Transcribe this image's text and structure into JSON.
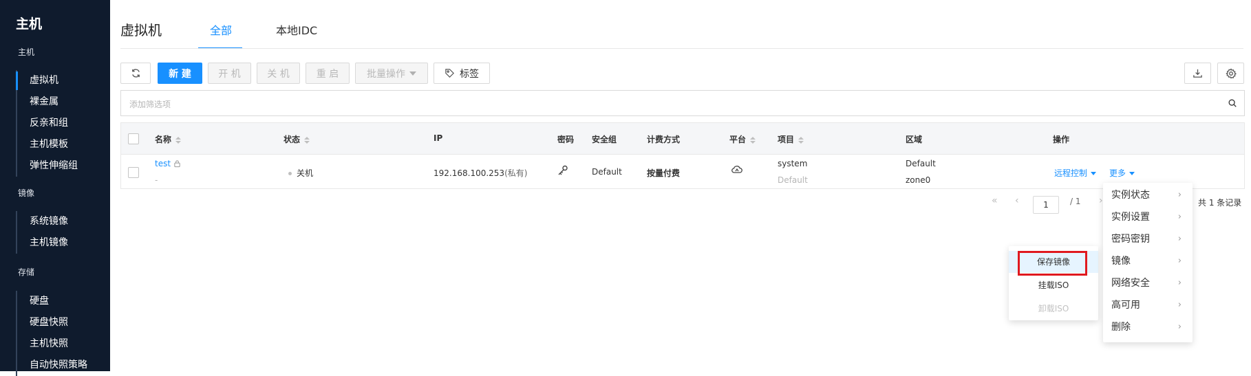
{
  "sidebar": {
    "title": "主机",
    "groups": [
      {
        "label": "主机",
        "items": [
          "虚拟机",
          "裸金属",
          "反亲和组",
          "主机模板",
          "弹性伸缩组"
        ]
      },
      {
        "label": "镜像",
        "items": [
          "系统镜像",
          "主机镜像"
        ]
      },
      {
        "label": "存储",
        "items": [
          "硬盘",
          "硬盘快照",
          "主机快照",
          "自动快照策略"
        ]
      }
    ],
    "active_item": "虚拟机"
  },
  "header": {
    "page_title": "虚拟机",
    "tabs": [
      {
        "label": "全部",
        "active": true
      },
      {
        "label": "本地IDC",
        "active": false
      }
    ]
  },
  "toolbar": {
    "new_label": "新 建",
    "start_label": "开 机",
    "stop_label": "关 机",
    "restart_label": "重 启",
    "batch_label": "批量操作",
    "tags_label": "标签"
  },
  "filter": {
    "placeholder": "添加筛选项"
  },
  "table": {
    "columns": [
      "名称",
      "状态",
      "IP",
      "密码",
      "安全组",
      "计费方式",
      "平台",
      "项目",
      "区域",
      "操作"
    ],
    "rows": [
      {
        "name": "test",
        "name_sub": "-",
        "status": "关机",
        "ip": "192.168.100.253",
        "ip_suffix": "(私有)",
        "security_group": "Default",
        "billing": "按量付费",
        "project": "system",
        "project_sub": "Default",
        "region": "Default",
        "zone": "zone0",
        "action_remote": "远程控制",
        "action_more": "更多"
      }
    ]
  },
  "pagination": {
    "current": "1",
    "total_pages": "/ 1",
    "total_text": "共 1 条记录"
  },
  "more_menu": {
    "items": [
      "实例状态",
      "实例设置",
      "密码密钥",
      "镜像",
      "网络安全",
      "高可用",
      "删除"
    ]
  },
  "image_submenu": {
    "items": [
      {
        "label": "保存镜像",
        "state": "highlighted"
      },
      {
        "label": "挂载ISO",
        "state": "normal"
      },
      {
        "label": "卸载ISO",
        "state": "disabled"
      }
    ]
  },
  "colors": {
    "sidebar_bg": "#0f1b2d",
    "accent": "#1890ff",
    "highlight_box": "#e0191f"
  }
}
